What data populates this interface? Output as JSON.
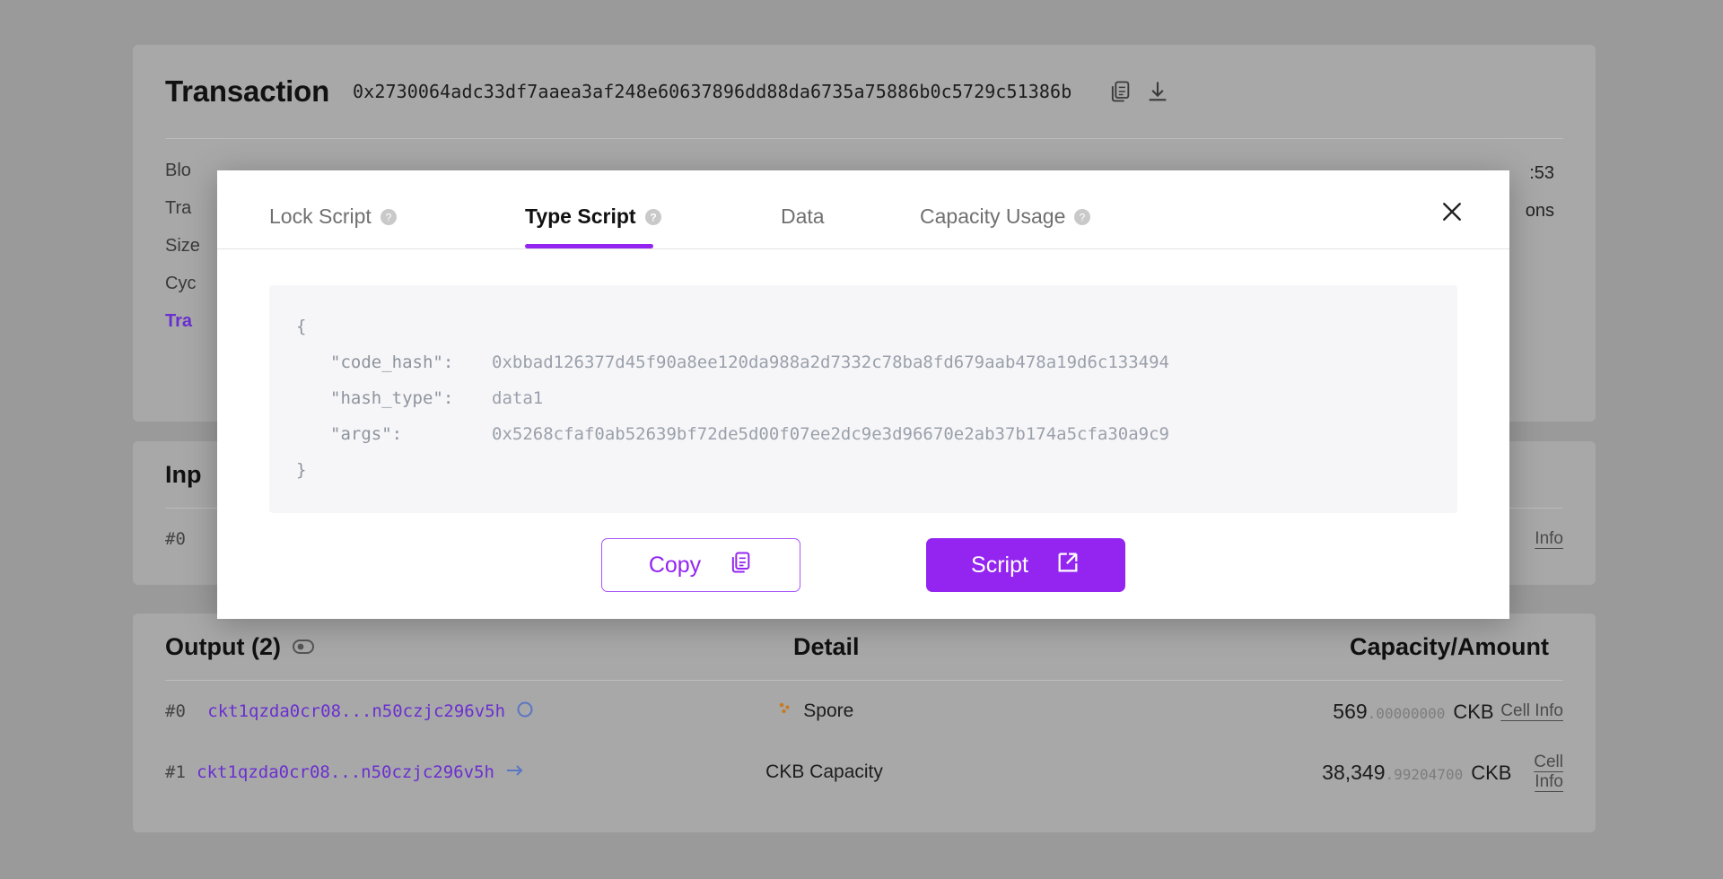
{
  "transaction": {
    "title": "Transaction",
    "hash": "0x2730064adc33df7aaea3af248e60637896dd88da6735a75886b0c5729c51386b",
    "copy_icon": "copy-icon",
    "download_icon": "download-icon",
    "meta": [
      {
        "label": "Blo",
        "value": ":53"
      },
      {
        "label": "Tra",
        "value": "ons"
      },
      {
        "label": "Size",
        "value": ""
      },
      {
        "label": "Cyc",
        "value": ""
      }
    ],
    "link_label": "Tra"
  },
  "input_section": {
    "title": "Inp",
    "rows": [
      {
        "index": "#0",
        "cell_info": "Info"
      }
    ]
  },
  "output_section": {
    "title": "Output (2)",
    "toggle_icon": "eye-toggle-icon",
    "columns": {
      "detail": "Detail",
      "amount": "Capacity/Amount"
    },
    "rows": [
      {
        "index": "#0",
        "address": "ckt1qzda0cr08...n50czjc296v5h",
        "address_icon": "circle-icon",
        "detail": "Spore",
        "detail_icon": "spore-icon",
        "amount_int": "569",
        "amount_dec": ".00000000",
        "unit": "CKB",
        "cell_info": "Cell Info"
      },
      {
        "index": "#1",
        "address": "ckt1qzda0cr08...n50czjc296v5h",
        "address_icon": "arrow-right-icon",
        "detail": "CKB Capacity",
        "detail_icon": "",
        "amount_int": "38,349",
        "amount_dec": ".99204700",
        "unit": "CKB",
        "cell_info": "Cell Info"
      }
    ]
  },
  "modal": {
    "tabs": [
      {
        "label": "Lock Script",
        "has_help": true,
        "active": false
      },
      {
        "label": "Type Script",
        "has_help": true,
        "active": true
      },
      {
        "label": "Data",
        "has_help": false,
        "active": false
      },
      {
        "label": "Capacity Usage",
        "has_help": true,
        "active": false
      }
    ],
    "close_icon": "close-icon",
    "help_icon": "help-circle-icon",
    "script": {
      "open_brace": "{",
      "close_brace": "}",
      "fields": [
        {
          "key": "\"code_hash\":",
          "value": "0xbbad126377d45f90a8ee120da988a2d7332c78ba8fd679aab478a19d6c133494"
        },
        {
          "key": "\"hash_type\":",
          "value": "data1"
        },
        {
          "key": "\"args\":",
          "value": "0x5268cfaf0ab52639bf72de5d00f07ee2dc9e3d96670e2ab37b174a5cfa30a9c9"
        }
      ]
    },
    "buttons": {
      "copy": {
        "label": "Copy",
        "icon": "copy-icon"
      },
      "script": {
        "label": "Script",
        "icon": "external-link-icon"
      }
    }
  },
  "colors": {
    "accent": "#9425f0",
    "link": "#6a2fd0",
    "page_bg": "#9a9a9a",
    "card_bg": "#a8a8a8",
    "code_bg": "#f6f6f8"
  }
}
